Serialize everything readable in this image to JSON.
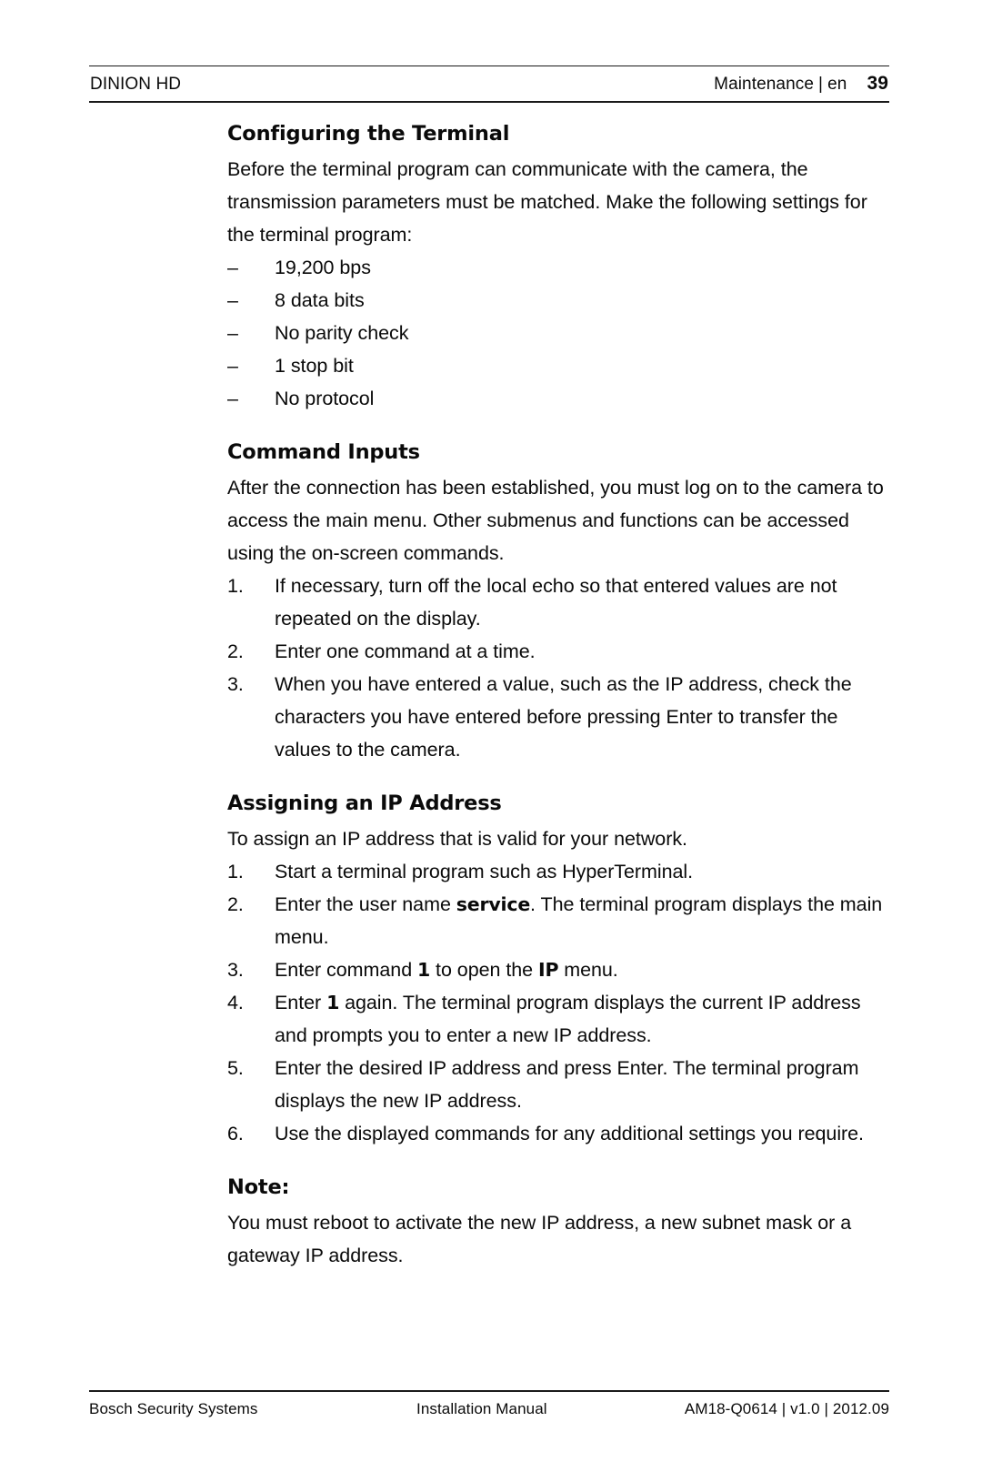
{
  "header": {
    "product": "DINION HD",
    "chapter": "Maintenance",
    "separator": "|",
    "language": "en",
    "page_number": "39"
  },
  "sections": [
    {
      "heading": "Configuring the Terminal",
      "intro": "Before the terminal program can communicate with the camera, the transmission parameters must be matched. Make the following settings for the terminal program:",
      "list_type": "dash",
      "dash_marker": "–",
      "items": [
        "19,200 bps",
        "8 data bits",
        "No parity check",
        "1 stop bit",
        "No protocol"
      ]
    },
    {
      "heading": "Command Inputs",
      "intro": "After the connection has been established, you must log on to the camera to access the main menu. Other submenus and functions can be accessed using the on-screen commands.",
      "list_type": "numbered",
      "items": [
        {
          "number": "1.",
          "text": "If necessary, turn off the local echo so that entered values are not repeated on the display."
        },
        {
          "number": "2.",
          "text": "Enter one command at a time."
        },
        {
          "number": "3.",
          "text": "When you have entered a value, such as the IP address, check the characters you have entered before pressing Enter to transfer the values to the camera."
        }
      ]
    },
    {
      "heading": "Assigning an IP Address",
      "intro": "To assign an IP address that is valid for your network.",
      "list_type": "numbered-rich",
      "items": [
        {
          "number": "1.",
          "runs": [
            {
              "t": "Start a terminal program such as HyperTerminal.",
              "b": false
            }
          ]
        },
        {
          "number": "2.",
          "runs": [
            {
              "t": "Enter the user name ",
              "b": false
            },
            {
              "t": "service",
              "b": true
            },
            {
              "t": ". The terminal program displays the main menu.",
              "b": false
            }
          ]
        },
        {
          "number": "3.",
          "runs": [
            {
              "t": "Enter command ",
              "b": false
            },
            {
              "t": "1",
              "b": true
            },
            {
              "t": " to open the ",
              "b": false
            },
            {
              "t": "IP",
              "b": true
            },
            {
              "t": " menu.",
              "b": false
            }
          ]
        },
        {
          "number": "4.",
          "runs": [
            {
              "t": "Enter ",
              "b": false
            },
            {
              "t": "1",
              "b": true
            },
            {
              "t": " again. The terminal program displays the current IP address and prompts you to enter a new IP address.",
              "b": false
            }
          ]
        },
        {
          "number": "5.",
          "runs": [
            {
              "t": "Enter the desired IP address and press Enter. The terminal program displays the new IP address.",
              "b": false
            }
          ]
        },
        {
          "number": "6.",
          "runs": [
            {
              "t": "Use the displayed commands for any additional settings you require.",
              "b": false
            }
          ]
        }
      ]
    }
  ],
  "note": {
    "heading": "Note:",
    "text": "You must reboot to activate the new IP address, a new subnet mask or a gateway IP address."
  },
  "footer": {
    "company": "Bosch Security Systems",
    "document_type": "Installation Manual",
    "document_id": "AM18-Q0614 | v1.0 | 2012.09"
  },
  "colors": {
    "text": "#0a0a0a",
    "rule": "#1a1a1a",
    "background": "#ffffff"
  }
}
